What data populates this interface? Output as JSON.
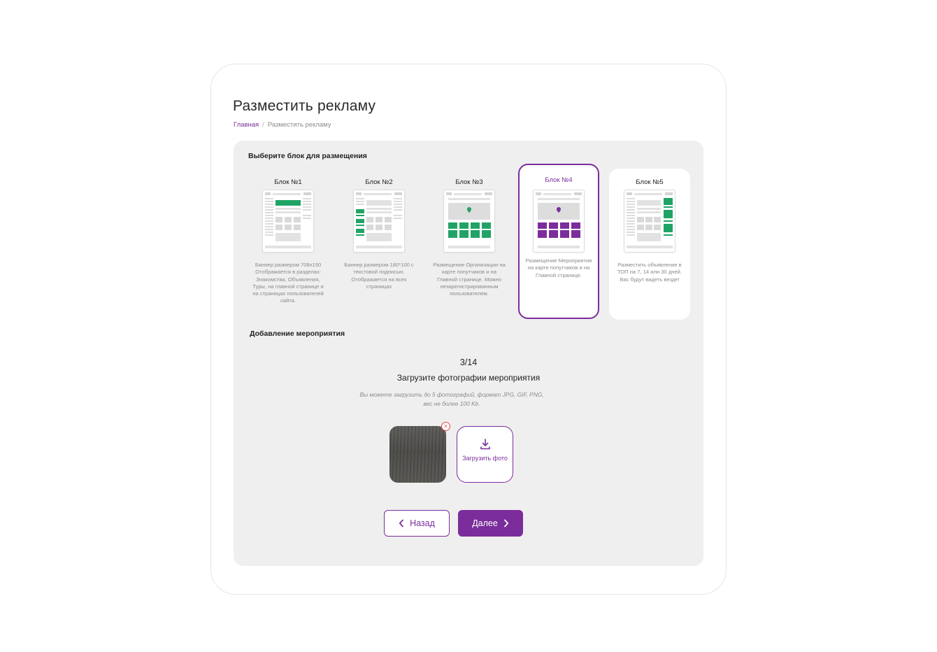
{
  "page": {
    "title": "Разместить рекламу"
  },
  "breadcrumb": {
    "home": "Главная",
    "separator": "/",
    "current": "Разместить рекламу"
  },
  "blocks_section": {
    "title": "Выберите блок для размещения"
  },
  "blocks": [
    {
      "title": "Блок №1",
      "description": "Баннер размером 708х150 Отображается в разделах: Знакомства, Объявления, Туры, на главной странице и на страницах пользователей сайта.",
      "selected": false
    },
    {
      "title": "Блок №2",
      "description": "Баннер размером 180*100 с текстовой подписью. Отображается на всех страницах",
      "selected": false
    },
    {
      "title": "Блок №3",
      "description": "Размещение Организации на карте попутчиков и на Главной странице. Можно незарегистрированным пользователем.",
      "selected": false
    },
    {
      "title": "Блок №4",
      "description": "Размещение Мероприятия на карте попутчиков и на Главной странице.",
      "selected": true
    },
    {
      "title": "Блок №5",
      "description": "Разместить объявление в ТОП на 7, 14 или 30 дней. Вас будут видеть везде!",
      "selected": false
    }
  ],
  "event_section": {
    "title": "Добавление мероприятия"
  },
  "step": {
    "counter": "3/14",
    "title": "Загрузите фотографии мероприятия",
    "hint": "Вы можете загрузить до 5 фотографий, формат JPG, GIF, PNG, вес не более 100 Kb."
  },
  "upload": {
    "button_label": "Загрузить фото",
    "remove_symbol": "×"
  },
  "nav": {
    "back_label": "Назад",
    "next_label": "Далее"
  },
  "colors": {
    "accent": "#7b2d9b",
    "green": "#21a366",
    "panel": "#efefef"
  },
  "icons": {
    "back": "chevron-left-icon",
    "next": "chevron-right-icon",
    "upload": "download-icon",
    "remove": "close-icon",
    "map_pin": "map-pin-icon"
  }
}
